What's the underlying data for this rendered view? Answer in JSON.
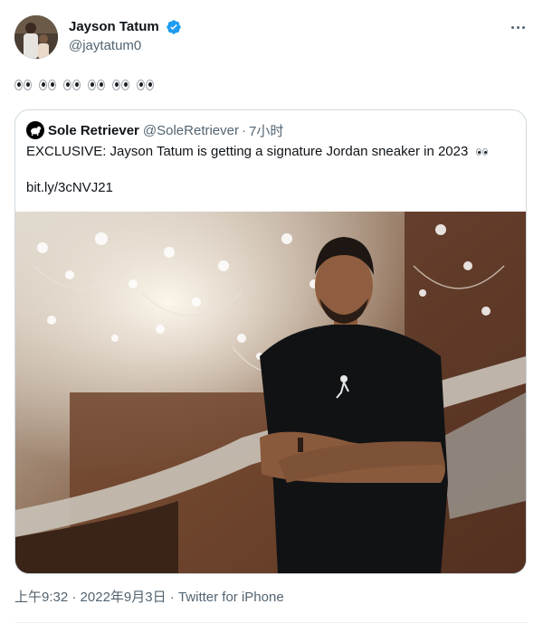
{
  "author": {
    "display_name": "Jayson Tatum",
    "handle": "@jaytatum0",
    "verified": true,
    "verified_color": "#1d9bf0"
  },
  "tweet": {
    "text_emoji": "eyes x6",
    "eyes_count": 6
  },
  "quoted": {
    "display_name": "Sole Retriever",
    "handle": "@SoleRetriever",
    "separator": "·",
    "time": "7小时",
    "text": "EXCLUSIVE: Jayson Tatum is getting a signature Jordan sneaker in 2023",
    "link": "bit.ly/3cNVJ21",
    "photo_icon": "photo-of-man-in-black-jordan-shirt"
  },
  "footer": {
    "time": "上午9:32",
    "separator1": " · ",
    "date": "2022年9月3日",
    "separator2": " · ",
    "source": "Twitter for iPhone"
  },
  "icons": {
    "more": "more-horizontal-icon",
    "verified": "verified-badge-icon"
  },
  "colors": {
    "text": "#0f1419",
    "secondary": "#536471",
    "border": "#cfd9de"
  }
}
